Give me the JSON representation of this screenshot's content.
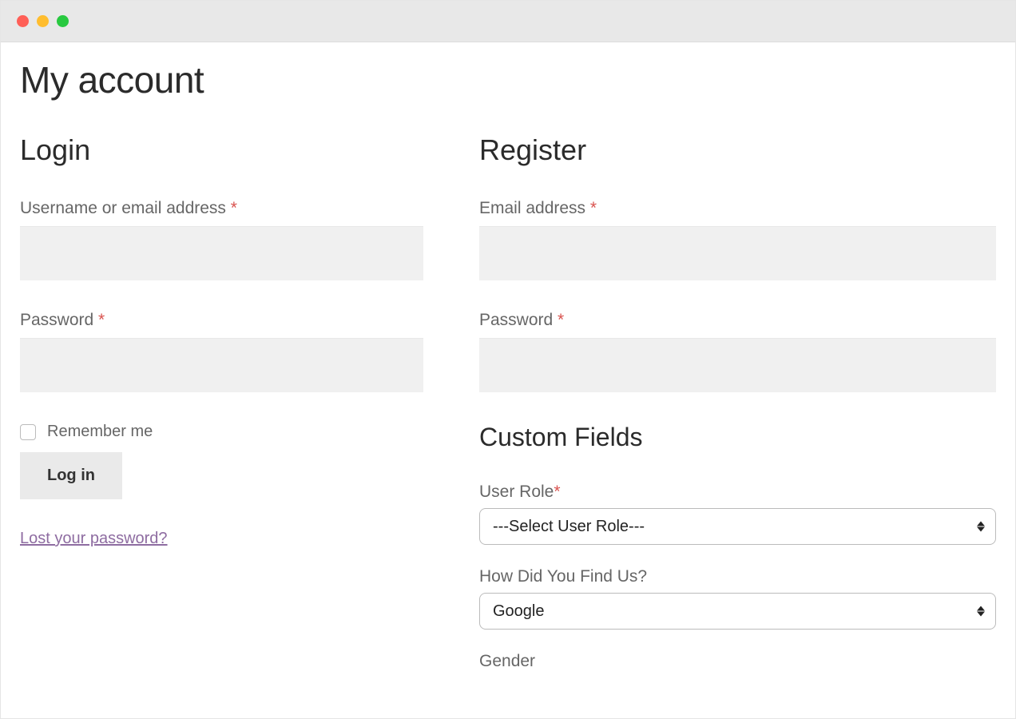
{
  "page": {
    "title": "My account"
  },
  "login": {
    "heading": "Login",
    "username_label": "Username or email address ",
    "password_label": "Password ",
    "remember_label": "Remember me",
    "button_label": "Log in",
    "lost_password_label": "Lost your password?"
  },
  "register": {
    "heading": "Register",
    "email_label": "Email address ",
    "password_label": "Password ",
    "custom_fields_heading": "Custom Fields",
    "user_role_label": "User Role",
    "user_role_selected": "---Select User Role---",
    "find_us_label": "How Did You Find Us?",
    "find_us_selected": "Google",
    "gender_label": "Gender"
  },
  "required_marker": "*"
}
